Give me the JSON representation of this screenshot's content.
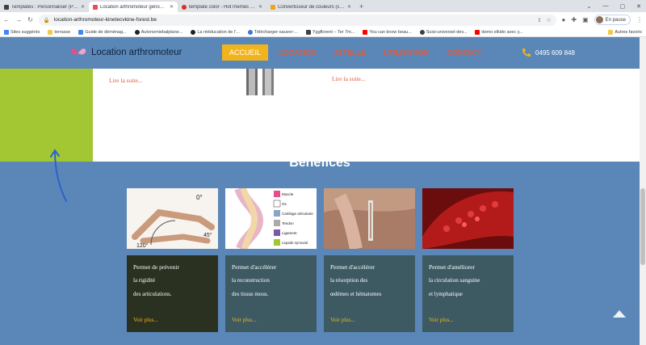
{
  "browser": {
    "tabs": [
      {
        "label": "Templates : Personnaliser (Pyth...",
        "color": "#3c4043"
      },
      {
        "label": "Location arthromoteur genou/h...",
        "color": "#e84c5c"
      },
      {
        "label": "template color - HotThemes for...",
        "color": "#d93025"
      },
      {
        "label": "Convertisseur de couleurs (conv...",
        "color": "#f2a21c"
      }
    ],
    "active_tab_index": 1,
    "new_tab": "+",
    "url": "location-arthromoteur-kinetecvkine-forest.be",
    "profile_label": "En pause",
    "bookmarks": [
      {
        "label": "Sites suggérés",
        "color": "#4285f4"
      },
      {
        "label": "terrasse",
        "color": "#f2c94c"
      },
      {
        "label": "Guide de déménag...",
        "color": "#4285f4"
      },
      {
        "label": "Autonomiebalplane...",
        "color": "#202124"
      },
      {
        "label": "La rééducation de l'...",
        "color": "#202124"
      },
      {
        "label": "Télécharger-sauver-...",
        "color": "#3c78d8"
      },
      {
        "label": "Yggflorent – Ter 7m...",
        "color": "#3c4043"
      },
      {
        "label": "You can know beau...",
        "color": "#ff0000"
      },
      {
        "label": "Suisi-universel-dev...",
        "color": "#3c4043"
      },
      {
        "label": "demo elkido avec y...",
        "color": "#ff0000"
      }
    ],
    "bookmarks_end": "Autres favoris"
  },
  "site": {
    "logo_text": "Location arthromoteur",
    "menu": [
      "ACCUEIL",
      "LOCATION",
      "ATTELLE",
      "UTILISATION",
      "CONTACT"
    ],
    "phone": "0495 609 848",
    "read_more_1": "Lire la suite...",
    "read_more_2": "Lire la suite...",
    "section_title": "Bénéfices",
    "cards": [
      {
        "title": "Permet de prévenir",
        "line1": "la rigidité",
        "line2": "des articulations.",
        "more": "Voir plus...",
        "bg": "#2b3120"
      },
      {
        "title": "Permet d'accélérer",
        "line1": "la reconstruction",
        "line2": "des tissus mous.",
        "more": "Voir plus...",
        "bg": "#3d5a63"
      },
      {
        "title": "Permet d'accélérer",
        "line1": "la résorption des",
        "line2": "œdèmes et hématomes",
        "more": "Voir plus...",
        "bg": "#3d5a63"
      },
      {
        "title": "Permet d'améliorer",
        "line1": "la circulation sanguine",
        "line2": "et lymphatique",
        "more": "Voir plus...",
        "bg": "#3d5a63"
      }
    ],
    "diagram_labels": [
      "Muscle",
      "Os",
      "Cartilage articulaire",
      "Tendon",
      "Ligament",
      "Liquide synovial"
    ],
    "angle_labels": [
      "0°",
      "45°",
      "120°"
    ],
    "colors": {
      "nav_bg": "#5a87b8",
      "accent": "#f2b41c",
      "menu_text": "#e05a3c",
      "green_block": "#a3c733"
    }
  }
}
